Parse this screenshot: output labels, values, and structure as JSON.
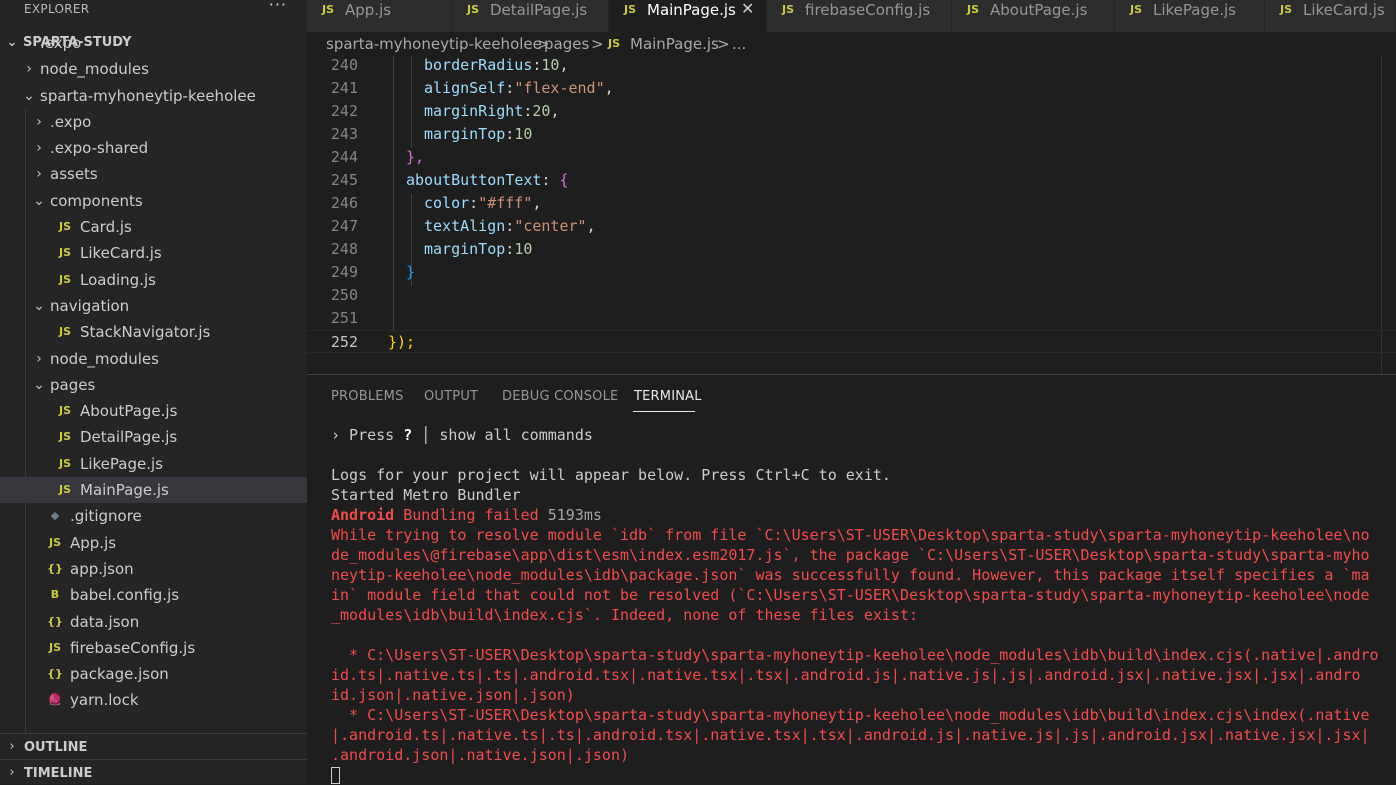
{
  "sidebar": {
    "header": "EXPLORER",
    "more": "···",
    "root": "SPARTA-STUDY",
    "items": [
      {
        "label": ".expo",
        "icon": ""
      },
      {
        "label": "node_modules",
        "icon": ""
      },
      {
        "label": "sparta-myhoneytip-keeholee",
        "icon": ""
      },
      {
        "label": ".expo",
        "icon": ""
      },
      {
        "label": ".expo-shared",
        "icon": ""
      },
      {
        "label": "assets",
        "icon": ""
      },
      {
        "label": "components",
        "icon": ""
      },
      {
        "label": "Card.js",
        "icon": "JS"
      },
      {
        "label": "LikeCard.js",
        "icon": "JS"
      },
      {
        "label": "Loading.js",
        "icon": "JS"
      },
      {
        "label": "navigation",
        "icon": ""
      },
      {
        "label": "StackNavigator.js",
        "icon": "JS"
      },
      {
        "label": "node_modules",
        "icon": ""
      },
      {
        "label": "pages",
        "icon": ""
      },
      {
        "label": "AboutPage.js",
        "icon": "JS"
      },
      {
        "label": "DetailPage.js",
        "icon": "JS"
      },
      {
        "label": "LikePage.js",
        "icon": "JS"
      },
      {
        "label": "MainPage.js",
        "icon": "JS"
      },
      {
        "label": ".gitignore",
        "icon": "◆"
      },
      {
        "label": "App.js",
        "icon": "JS"
      },
      {
        "label": "app.json",
        "icon": "{}"
      },
      {
        "label": "babel.config.js",
        "icon": "B"
      },
      {
        "label": "data.json",
        "icon": "{}"
      },
      {
        "label": "firebaseConfig.js",
        "icon": "JS"
      },
      {
        "label": "package.json",
        "icon": "{}"
      },
      {
        "label": "yarn.lock",
        "icon": "🧶"
      }
    ],
    "outline": "OUTLINE",
    "timeline": "TIMELINE"
  },
  "tabs": [
    {
      "label": "App.js",
      "icon": "JS"
    },
    {
      "label": "DetailPage.js",
      "icon": "JS"
    },
    {
      "label": "MainPage.js",
      "icon": "JS",
      "close": "✕"
    },
    {
      "label": "firebaseConfig.js",
      "icon": "JS"
    },
    {
      "label": "AboutPage.js",
      "icon": "JS"
    },
    {
      "label": "LikePage.js",
      "icon": "JS"
    },
    {
      "label": "LikeCard.js",
      "icon": "JS"
    }
  ],
  "breadcrumb": {
    "part1": "sparta-myhoneytip-keeholee",
    "sep1": ">",
    "part2": "pages",
    "sep2": ">",
    "icon": "JS",
    "part3": "MainPage.js",
    "sep3": ">",
    "part4": "..."
  },
  "editor": {
    "lines": [
      {
        "num": "240",
        "prop": "borderRadius",
        "colon": ":",
        "val": "10",
        "vclass": "num",
        "tail": ","
      },
      {
        "num": "241",
        "prop": "alignSelf",
        "colon": ":",
        "val": "\"flex-end\"",
        "vclass": "str",
        "tail": ","
      },
      {
        "num": "242",
        "prop": "marginRight",
        "colon": ":",
        "val": "20",
        "vclass": "num",
        "tail": ","
      },
      {
        "num": "243",
        "prop": "marginTop",
        "colon": ":",
        "val": "10",
        "vclass": "num",
        "tail": ""
      },
      {
        "num": "244",
        "text": "},"
      },
      {
        "num": "245",
        "prop": "aboutButtonText",
        "colon": ": ",
        "val": "{",
        "vclass": "brk",
        "tail": ""
      },
      {
        "num": "246",
        "prop": "color",
        "colon": ":",
        "val": "\"#fff\"",
        "vclass": "str",
        "tail": ","
      },
      {
        "num": "247",
        "prop": "textAlign",
        "colon": ":",
        "val": "\"center\"",
        "vclass": "str",
        "tail": ","
      },
      {
        "num": "248",
        "prop": "marginTop",
        "colon": ":",
        "val": "10",
        "vclass": "num",
        "tail": ""
      },
      {
        "num": "249",
        "text": "}"
      },
      {
        "num": "250",
        "text": ""
      },
      {
        "num": "251",
        "text": ""
      },
      {
        "num": "252",
        "text": "});"
      }
    ]
  },
  "panel": {
    "tabs": [
      "PROBLEMS",
      "OUTPUT",
      "DEBUG CONSOLE",
      "TERMINAL"
    ],
    "terminal": {
      "prompt_prefix": "› Press ",
      "prompt_key": "?",
      "prompt_sep": " │ ",
      "prompt_rest": "show all commands",
      "l1": "Logs for your project will appear below. Press Ctrl+C to exit.",
      "l2": "Started Metro Bundler",
      "l3a": "Android",
      "l3b": " Bundling failed ",
      "l3c": "5193ms",
      "err": [
        "While trying to resolve module `idb` from file `C:\\Users\\ST-USER\\Desktop\\sparta-study\\sparta-myhoneytip-keeholee\\no",
        "de_modules\\@firebase\\app\\dist\\esm\\index.esm2017.js`, the package `C:\\Users\\ST-USER\\Desktop\\sparta-study\\sparta-myho",
        "neytip-keeholee\\node_modules\\idb\\package.json` was successfully found. However, this package itself specifies a `ma",
        "in` module field that could not be resolved (`C:\\Users\\ST-USER\\Desktop\\sparta-study\\sparta-myhoneytip-keeholee\\node",
        "_modules\\idb\\build\\index.cjs`. Indeed, none of these files exist:",
        "",
        "  * C:\\Users\\ST-USER\\Desktop\\sparta-study\\sparta-myhoneytip-keeholee\\node_modules\\idb\\build\\index.cjs(.native|.andro",
        "id.ts|.native.ts|.ts|.android.tsx|.native.tsx|.tsx|.android.js|.native.js|.js|.android.jsx|.native.jsx|.jsx|.andro",
        "id.json|.native.json|.json)",
        "  * C:\\Users\\ST-USER\\Desktop\\sparta-study\\sparta-myhoneytip-keeholee\\node_modules\\idb\\build\\index.cjs\\index(.native",
        "|.android.ts|.native.ts|.ts|.android.tsx|.native.tsx|.tsx|.android.js|.native.js|.js|.android.jsx|.native.jsx|.jsx|",
        ".android.json|.native.json|.json)"
      ]
    }
  },
  "colors": {
    "js_icon": "#cbcb41",
    "json_icon": "#cbcb41",
    "error_red": "#f14c4c"
  }
}
